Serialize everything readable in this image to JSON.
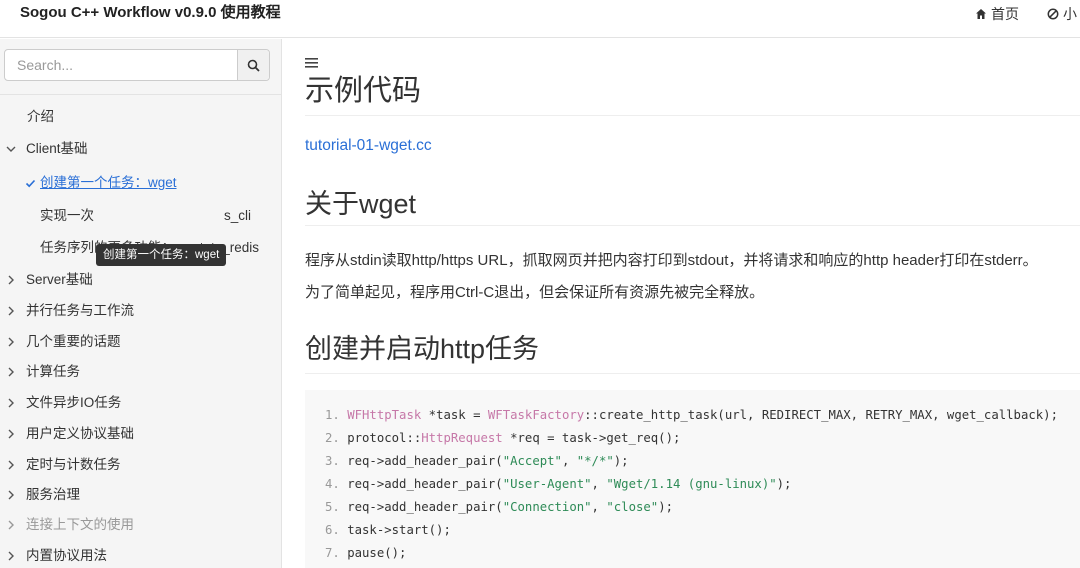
{
  "header": {
    "title": "Sogou C++ Workflow v0.9.0 使用教程",
    "nav_home": "首页",
    "nav_other": "小"
  },
  "sidebar": {
    "search_placeholder": "Search...",
    "items": [
      {
        "label": "介绍",
        "state": "leaf"
      },
      {
        "label": "Client基础",
        "state": "expanded"
      },
      {
        "label": "创建第一个任务：wget",
        "state": "active"
      },
      {
        "label": "实现一次",
        "suffix": "s_cli",
        "state": "child"
      },
      {
        "label": "任务序列的更多功能：wget_to_redis",
        "state": "child"
      },
      {
        "label": "Server基础",
        "state": "collapsed"
      },
      {
        "label": "并行任务与工作流",
        "state": "collapsed"
      },
      {
        "label": "几个重要的话题",
        "state": "collapsed"
      },
      {
        "label": "计算任务",
        "state": "collapsed"
      },
      {
        "label": "文件异步IO任务",
        "state": "collapsed"
      },
      {
        "label": "用户定义协议基础",
        "state": "collapsed"
      },
      {
        "label": "定时与计数任务",
        "state": "collapsed"
      },
      {
        "label": "服务治理",
        "state": "collapsed"
      },
      {
        "label": "连接上下文的使用",
        "state": "collapsed-muted"
      },
      {
        "label": "内置协议用法",
        "state": "collapsed"
      }
    ],
    "tooltip": "创建第一个任务：wget"
  },
  "main": {
    "h1": "示例代码",
    "link": "tutorial-01-wget.cc",
    "h2": "关于wget",
    "para1": "程序从stdin读取http/https URL，抓取网页并把内容打印到stdout，并将请求和响应的http header打印在stderr。",
    "para2": "为了简单起见，程序用Ctrl-C退出，但会保证所有资源先被完全释放。",
    "h3": "创建并启动http任务",
    "code": [
      {
        "n": "1.",
        "parts": [
          [
            "ty",
            "WFHttpTask"
          ],
          [
            "fn",
            " *task = "
          ],
          [
            "ty",
            "WFTaskFactory"
          ],
          [
            "fn",
            "::create_http_task(url, REDIRECT_MAX, RETRY_MAX, wget_callback);"
          ]
        ]
      },
      {
        "n": "2.",
        "parts": [
          [
            "fn",
            "protocol::"
          ],
          [
            "ty",
            "HttpRequest"
          ],
          [
            "fn",
            " *req = task->get_req();"
          ]
        ]
      },
      {
        "n": "3.",
        "parts": [
          [
            "fn",
            "req->add_header_pair("
          ],
          [
            "str",
            "\"Accept\""
          ],
          [
            "fn",
            ", "
          ],
          [
            "str",
            "\"*/*\""
          ],
          [
            "fn",
            ");"
          ]
        ]
      },
      {
        "n": "4.",
        "parts": [
          [
            "fn",
            "req->add_header_pair("
          ],
          [
            "str",
            "\"User-Agent\""
          ],
          [
            "fn",
            ", "
          ],
          [
            "str",
            "\"Wget/1.14 (gnu-linux)\""
          ],
          [
            "fn",
            ");"
          ]
        ]
      },
      {
        "n": "5.",
        "parts": [
          [
            "fn",
            "req->add_header_pair("
          ],
          [
            "str",
            "\"Connection\""
          ],
          [
            "fn",
            ", "
          ],
          [
            "str",
            "\"close\""
          ],
          [
            "fn",
            ");"
          ]
        ]
      },
      {
        "n": "6.",
        "parts": [
          [
            "fn",
            "task->start();"
          ]
        ]
      },
      {
        "n": "7.",
        "parts": [
          [
            "fn",
            "pause();"
          ]
        ]
      }
    ]
  },
  "colors": {
    "link": "#2a6fd6",
    "sidebar_bg": "#f5f5f5",
    "code_bg": "#f8f8f8",
    "string": "#2e8b57",
    "type": "#c678a8"
  }
}
